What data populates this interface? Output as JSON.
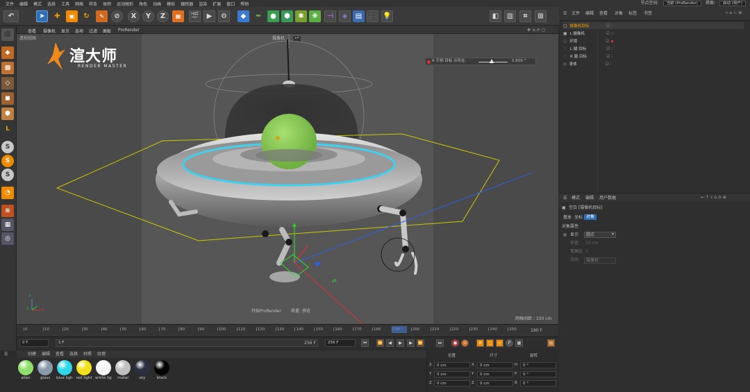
{
  "menubar": {
    "items": [
      "文件",
      "编辑",
      "模式",
      "选择",
      "工具",
      "网格",
      "样条",
      "体积",
      "运动图形",
      "角色",
      "动画",
      "模拟",
      "跟踪器",
      "渲染",
      "扩展",
      "窗口",
      "帮助"
    ],
    "node_space_label": "节点空间:",
    "node_space_value": "当前 (ProRender)",
    "layout_label": "界面:",
    "layout_value": "启动 (用户)"
  },
  "toolbar": {
    "axis_x": "X",
    "axis_y": "Y",
    "axis_z": "Z"
  },
  "viewport": {
    "menu": [
      "查看",
      "摄像机",
      "显示",
      "选项",
      "过滤",
      "面板",
      "ProRender"
    ],
    "view_name": "透视视图",
    "camera_label": "摄像机",
    "camera_icon": "•*",
    "hud_slider_label": "R 手柄 目标 点所在:",
    "hud_slider_value": "5.859 °",
    "logo_main": "渲大师",
    "logo_sub": "RENDER MASTER",
    "bottom_center_1": "开始ProRender",
    "bottom_center_2": "质量: 预览",
    "grid_label": "网格间距 : 100 cm",
    "axis_label_y": "Y",
    "axis_label_z": "Z",
    "axis_label_x": "X"
  },
  "object_manager": {
    "tabs": [
      "文件",
      "编辑",
      "查看",
      "对象",
      "标签",
      "书签"
    ],
    "rows": [
      {
        "name": "摄像机目标",
        "icon": "camera-target-icon"
      },
      {
        "name": "L 摄像机",
        "icon": "camera-icon"
      },
      {
        "name": "环境",
        "icon": "environment-icon"
      },
      {
        "name": "L 腿 目标",
        "icon": "null-icon"
      },
      {
        "name": "R 腿 目标",
        "icon": "null-icon"
      },
      {
        "name": "身体",
        "icon": "object-icon"
      }
    ]
  },
  "attribute_manager": {
    "tabs": [
      "模式",
      "编辑",
      "用户数据"
    ],
    "object_title": "空白 [摄像机目标]",
    "subtabs": [
      "基本",
      "坐标",
      "对象"
    ],
    "section": "对象属性",
    "fields": [
      {
        "label": "显示",
        "value": "圆点"
      },
      {
        "label": "半径",
        "value": "10 cm"
      },
      {
        "label": "宽高比",
        "value": "1"
      },
      {
        "label": "方向",
        "value": "摄像机"
      }
    ]
  },
  "timeline": {
    "ticks": [
      "0",
      "10",
      "20",
      "30",
      "40",
      "50",
      "60",
      "70",
      "80",
      "90",
      "100",
      "110",
      "120",
      "130",
      "140",
      "150",
      "160",
      "170",
      "180",
      "190",
      "200",
      "210",
      "220",
      "230",
      "240",
      "250"
    ],
    "current": "190 F"
  },
  "playbar": {
    "start": "0 F",
    "current": "1 F",
    "range_end": "256 F",
    "end": "256 F"
  },
  "material_manager": {
    "menu": [
      "创建",
      "编辑",
      "查看",
      "选择",
      "材质",
      "纹理"
    ],
    "materials": [
      {
        "name": "alien",
        "color": "#8fe06a"
      },
      {
        "name": "glass",
        "color": "#8a9aa8"
      },
      {
        "name": "blue light",
        "color": "#2fd8e8"
      },
      {
        "name": "red light",
        "color": "#f2e11a"
      },
      {
        "name": "white light",
        "color": "#f4f4f4"
      },
      {
        "name": "metal",
        "color": "#bfbfbf"
      },
      {
        "name": "sky",
        "color": "#2a3040"
      },
      {
        "name": "black",
        "color": "#050505"
      }
    ]
  },
  "coordinates": {
    "headers": [
      "位置",
      "尺寸",
      "旋转"
    ],
    "rows": [
      {
        "a": "X",
        "pos": "0 cm",
        "b": "X",
        "size": "0 cm",
        "c": "H",
        "rot": "0 °"
      },
      {
        "a": "Y",
        "pos": "0 cm",
        "b": "Y",
        "size": "0 cm",
        "c": "P",
        "rot": "0 °"
      },
      {
        "a": "Z",
        "pos": "0 cm",
        "b": "Z",
        "size": "0 cm",
        "c": "B",
        "rot": "0 °"
      }
    ]
  },
  "colors": {
    "accent": "#f0a000",
    "selected": "#2f6fb5",
    "ring": "#3fd0f0",
    "alien": "#8fd05a"
  }
}
